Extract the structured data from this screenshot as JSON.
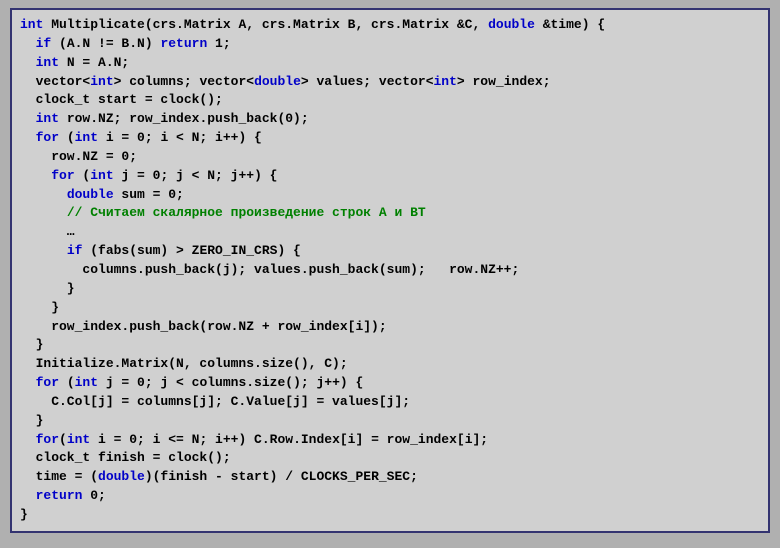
{
  "code": {
    "l1a": "int",
    "l1b": " Multiplicate(crs.Matrix A, crs.Matrix B, crs.Matrix &C, ",
    "l1c": "double",
    "l1d": " &time) {",
    "l2a": "  ",
    "l2b": "if",
    "l2c": " (A.N != B.N) ",
    "l2d": "return",
    "l2e": " 1;",
    "l3a": "  ",
    "l3b": "int",
    "l3c": " N = A.N;",
    "l4a": "  vector<",
    "l4b": "int",
    "l4c": "> columns; vector<",
    "l4d": "double",
    "l4e": "> values; vector<",
    "l4f": "int",
    "l4g": "> row_index;",
    "l5": "  clock_t start = clock();",
    "l6a": "  ",
    "l6b": "int",
    "l6c": " row.NZ; row_index.push_back(0);",
    "l7a": "  ",
    "l7b": "for",
    "l7c": " (",
    "l7d": "int",
    "l7e": " i = 0; i < N; i++) {",
    "l8": "    row.NZ = 0;",
    "l9a": "    ",
    "l9b": "for",
    "l9c": " (",
    "l9d": "int",
    "l9e": " j = 0; j < N; j++) {",
    "l10a": "      ",
    "l10b": "double",
    "l10c": " sum = 0;",
    "l11a": "      ",
    "l11b": "// Считаем скалярное произведение строк A и BT",
    "l12": "      …",
    "l13a": "      ",
    "l13b": "if",
    "l13c": " (fabs(sum) > ZERO_IN_CRS) {",
    "l14": "        columns.push_back(j); values.push_back(sum);   row.NZ++;",
    "l15": "      }",
    "l16": "    }",
    "l17": "    row_index.push_back(row.NZ + row_index[i]);",
    "l18": "  }",
    "l19": "  Initialize.Matrix(N, columns.size(), C);",
    "l20a": "  ",
    "l20b": "for",
    "l20c": " (",
    "l20d": "int",
    "l20e": " j = 0; j < columns.size(); j++) {",
    "l21": "    C.Col[j] = columns[j]; C.Value[j] = values[j];",
    "l22": "  }",
    "l23a": "  ",
    "l23b": "for",
    "l23c": "(",
    "l23d": "int",
    "l23e": " i = 0; i <= N; i++) C.Row.Index[i] = row_index[i];",
    "l24": "  clock_t finish = clock();",
    "l25a": "  time = (",
    "l25b": "double",
    "l25c": ")(finish - start) / CLOCKS_PER_SEC;",
    "l26a": "  ",
    "l26b": "return",
    "l26c": " 0;",
    "l27": "}"
  }
}
